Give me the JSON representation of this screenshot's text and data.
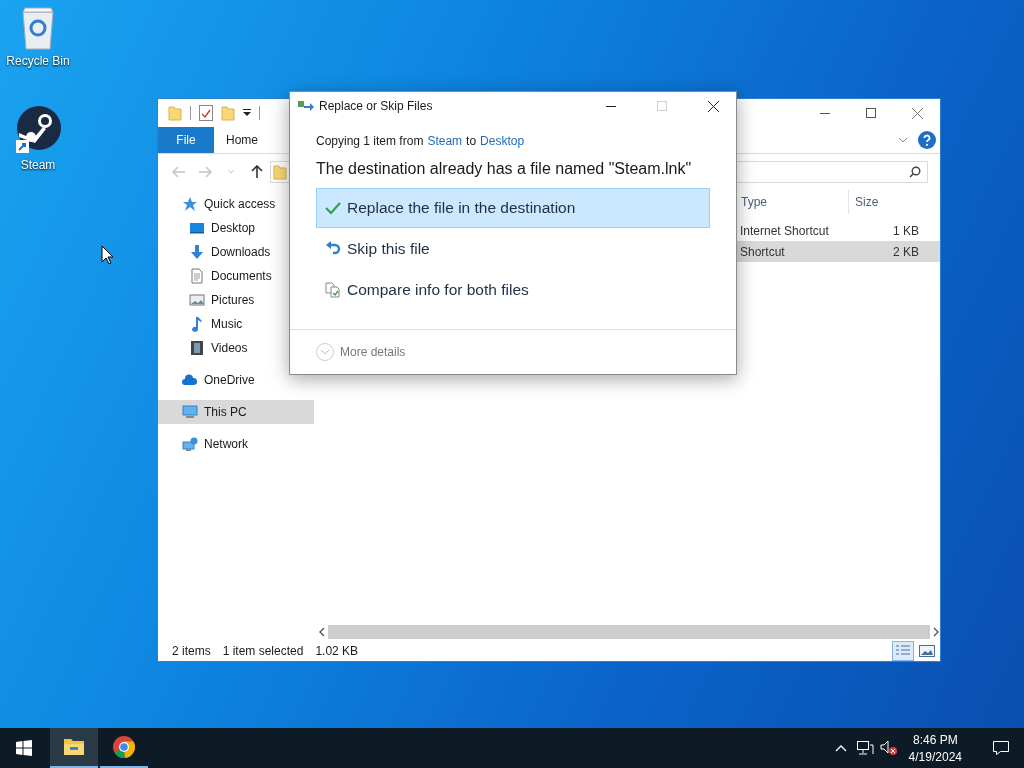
{
  "desktop_icons": [
    {
      "label": "Recycle Bin",
      "kind": "recycle"
    },
    {
      "label": "Steam",
      "kind": "steam"
    }
  ],
  "explorer": {
    "ribbon_tabs": [
      {
        "label": "File",
        "selected": true
      },
      {
        "label": "Home",
        "selected": false
      }
    ],
    "nav_buttons": [
      {
        "kind": "back",
        "disabled": true
      },
      {
        "kind": "forward",
        "disabled": true
      },
      {
        "kind": "recent",
        "disabled": true
      },
      {
        "kind": "up",
        "disabled": false
      }
    ],
    "nav": [
      {
        "label": "Quick access",
        "kind": "star",
        "selected": false,
        "children": [
          {
            "label": "Desktop",
            "kind": "desktop",
            "selected": false
          },
          {
            "label": "Downloads",
            "kind": "download",
            "selected": false
          },
          {
            "label": "Documents",
            "kind": "document",
            "selected": false
          },
          {
            "label": "Pictures",
            "kind": "picture",
            "selected": false
          },
          {
            "label": "Music",
            "kind": "music",
            "selected": false
          },
          {
            "label": "Videos",
            "kind": "video",
            "selected": false
          }
        ]
      },
      {
        "label": "OneDrive",
        "kind": "cloud",
        "selected": false
      },
      {
        "label": "This PC",
        "kind": "pc",
        "selected": true
      },
      {
        "label": "Network",
        "kind": "network",
        "selected": false
      }
    ],
    "columns": [
      "Type",
      "Size"
    ],
    "rows": [
      {
        "type": "Internet Shortcut",
        "size": "1 KB",
        "selected": false
      },
      {
        "type": "Shortcut",
        "size": "2 KB",
        "selected": true
      }
    ],
    "status": {
      "items": "2 items",
      "selection": "1 item selected",
      "size": "1.02 KB"
    },
    "views": [
      {
        "kind": "details",
        "selected": true
      },
      {
        "kind": "large",
        "selected": false
      }
    ]
  },
  "dialog": {
    "title": "Replace or Skip Files",
    "controls": [
      {
        "kind": "minimize",
        "disabled": false
      },
      {
        "kind": "maximize",
        "disabled": true
      },
      {
        "kind": "close",
        "disabled": false
      }
    ],
    "copying_prefix": "Copying 1 item from",
    "source": "Steam",
    "copying_middle": "to",
    "destination": "Desktop",
    "heading": "The destination already has a file named \"Steam.lnk\"",
    "options": [
      {
        "kind": "replace",
        "label": "Replace the file in the destination",
        "selected": true
      },
      {
        "kind": "skip",
        "label": "Skip this file",
        "selected": false
      },
      {
        "kind": "compare",
        "label": "Compare info for both files",
        "selected": false
      }
    ],
    "more_details": "More details"
  },
  "taskbar": {
    "apps": [
      {
        "kind": "explorer",
        "selected": true
      },
      {
        "kind": "chrome",
        "selected": false
      }
    ],
    "time": "8:46 PM",
    "date": "4/19/2024"
  }
}
